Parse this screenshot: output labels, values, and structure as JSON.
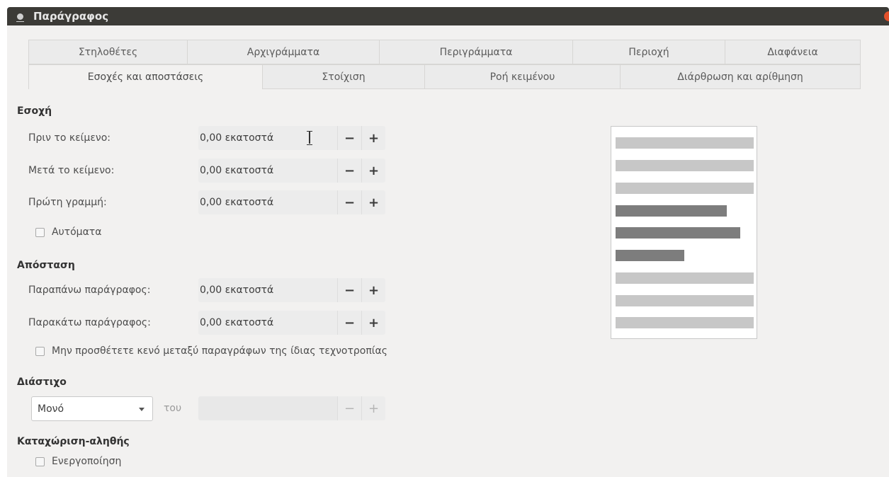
{
  "window": {
    "title": "Παράγραφος"
  },
  "tabs_row1": [
    {
      "label": "Στηλοθέτες"
    },
    {
      "label": "Αρχιγράμματα"
    },
    {
      "label": "Περιγράμματα"
    },
    {
      "label": "Περιοχή"
    },
    {
      "label": "Διαφάνεια"
    }
  ],
  "tabs_row2": [
    {
      "label": "Εσοχές και αποστάσεις",
      "active": true
    },
    {
      "label": "Στοίχιση"
    },
    {
      "label": "Ροή κειμένου"
    },
    {
      "label": "Διάρθρωση και αρίθμηση"
    }
  ],
  "indent": {
    "heading": "Εσοχή",
    "before_text": {
      "label": "Πριν το κείμενο:",
      "value": "0,00 εκατοστά"
    },
    "after_text": {
      "label": "Μετά το κείμενο:",
      "value": "0,00 εκατοστά"
    },
    "first_line": {
      "label": "Πρώτη γραμμή:",
      "value": "0,00 εκατοστά"
    },
    "automatic": {
      "label": "Αυτόματα",
      "checked": false
    }
  },
  "spacing": {
    "heading": "Απόσταση",
    "above": {
      "label": "Παραπάνω παράγραφος:",
      "value": "0,00 εκατοστά"
    },
    "below": {
      "label": "Παρακάτω παράγραφος:",
      "value": "0,00 εκατοστά"
    },
    "no_space": {
      "label": "Μην προσθέτετε κενό μεταξύ παραγράφων της ίδιας τεχνοτροπίας",
      "checked": false
    }
  },
  "line_spacing": {
    "heading": "Διάστιχο",
    "selected": "Μονό",
    "of_label": "του",
    "value": ""
  },
  "register_true": {
    "heading": "Καταχώριση-αληθής",
    "activate": {
      "label": "Ενεργοποίηση",
      "checked": false
    }
  },
  "spin": {
    "minus": "−",
    "plus": "+"
  },
  "colors": {
    "titlebar": "#3c3b37",
    "close": "#e2512b",
    "dialog_bg": "#f2f1f0",
    "preview_light": "#c7c7c7",
    "preview_dark": "#7d7d7d"
  }
}
